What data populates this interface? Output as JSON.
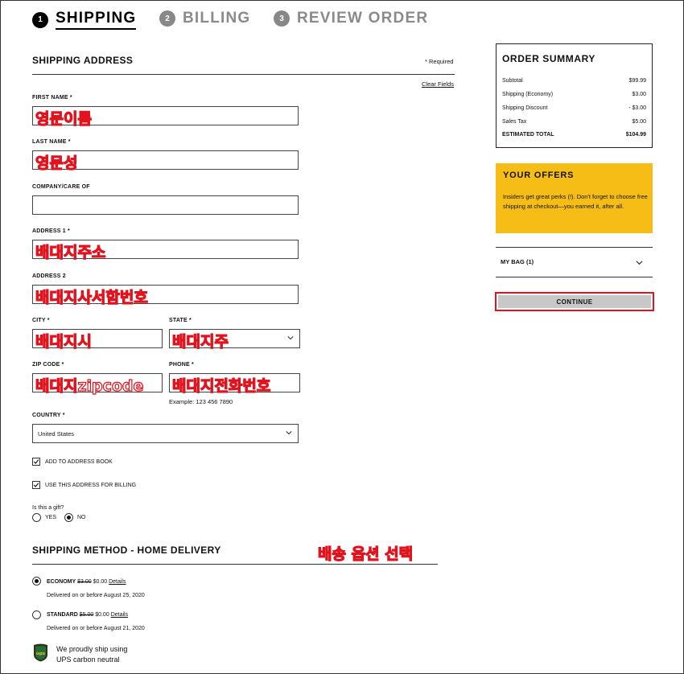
{
  "steps": [
    {
      "num": "1",
      "label": "SHIPPING"
    },
    {
      "num": "2",
      "label": "BILLING"
    },
    {
      "num": "3",
      "label": "REVIEW ORDER"
    }
  ],
  "shipping_address": {
    "title": "SHIPPING ADDRESS",
    "required_note": "* Required",
    "clear_fields": "Clear Fields"
  },
  "form": {
    "first_name": {
      "label": "FIRST NAME *",
      "value": "영문이름"
    },
    "last_name": {
      "label": "LAST NAME *",
      "value": "영문성"
    },
    "company": {
      "label": "COMPANY/CARE OF",
      "value": ""
    },
    "address1": {
      "label": "ADDRESS 1 *",
      "value": "배대지주소"
    },
    "address2": {
      "label": "ADDRESS 2",
      "value": "배대지사서함번호"
    },
    "city": {
      "label": "CITY *",
      "value": "배대지시"
    },
    "state": {
      "label": "STATE *",
      "value": "배대지주"
    },
    "zip": {
      "label": "ZIP CODE *",
      "value": "배대지zipcode"
    },
    "phone": {
      "label": "PHONE *",
      "value": "배대지전화번호",
      "example": "Example: 123 456 7890"
    },
    "country": {
      "label": "COUNTRY *",
      "value": "United States"
    }
  },
  "checkboxes": {
    "add_to_address_book": "ADD TO ADDRESS BOOK",
    "use_for_billing": "USE THIS ADDRESS FOR BILLING"
  },
  "gift": {
    "question": "Is this a gift?",
    "yes": "YES",
    "no": "NO",
    "selected": "NO"
  },
  "shipping_method": {
    "title": "SHIPPING METHOD - HOME DELIVERY",
    "annotation": "배송 옵션 선택",
    "options": [
      {
        "name": "ECONOMY",
        "old_price": "$3.00",
        "price": "$0.00",
        "details": "Details",
        "delivery": "Delivered on or before August 25, 2020",
        "selected": true
      },
      {
        "name": "STANDARD",
        "old_price": "$5.00",
        "price": "$0.00",
        "details": "Details",
        "delivery": "Delivered on or before August 21, 2020",
        "selected": false
      }
    ],
    "ups_note_line1": "We proudly ship using",
    "ups_note_line2": "UPS carbon neutral"
  },
  "order_summary": {
    "title": "ORDER SUMMARY",
    "rows": [
      {
        "label": "Subtotal",
        "value": "$99.99"
      },
      {
        "label": "Shipping (Economy)",
        "value": "$3.00"
      },
      {
        "label": "Shipping Discount",
        "value": "- $3.00"
      },
      {
        "label": "Sales Tax",
        "value": "$5.00"
      },
      {
        "label": "ESTIMATED TOTAL",
        "value": "$104.99"
      }
    ]
  },
  "offers": {
    "title": "YOUR OFFERS",
    "text": "Insiders get great perks (!). Don't forget to choose free shipping at checkout—you earned it, after all."
  },
  "my_bag": {
    "label": "MY BAG (1)"
  },
  "continue_label": "CONTINUE",
  "colors": {
    "annotation_red": "#e0141e",
    "offers_yellow": "#f6bd16",
    "button_gray": "#c8c8c8"
  }
}
